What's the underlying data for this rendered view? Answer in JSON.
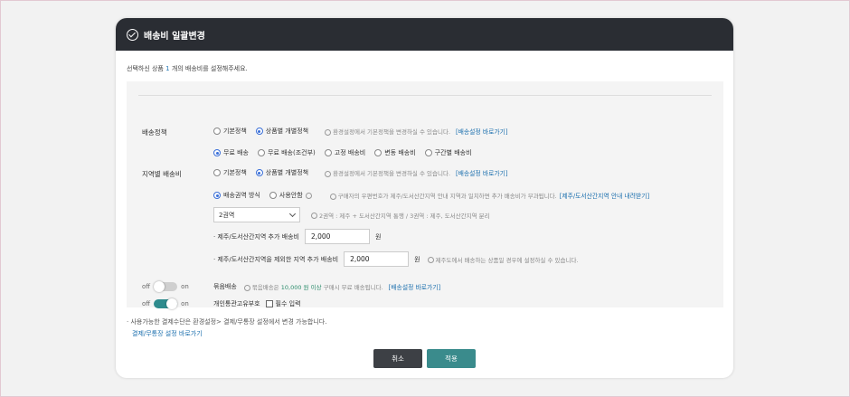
{
  "modal": {
    "title": "배송비 일괄변경",
    "desc_prefix": "선택하신 상품",
    "desc_count": "1",
    "desc_suffix": "개의 배송비를 설정해주세요."
  },
  "policy": {
    "label": "배송정책",
    "options": [
      "기본정책",
      "상품별 개별정책"
    ],
    "hint": "환경설정에서 기본정책을 변경하실 수 있습니다.",
    "link": "[배송설정 바로가기]",
    "fee_types": [
      "무료 배송",
      "무료 배송(조건부)",
      "고정 배송비",
      "변동 배송비",
      "구간별 배송비"
    ]
  },
  "region": {
    "label": "지역별 배송비",
    "options": [
      "기본정책",
      "상품별 개별정책"
    ],
    "hint": "환경설정에서 기본정책을 변경하실 수 있습니다.",
    "link": "[배송설정 바로가기]",
    "methods": [
      "배송권역 방식",
      "사용안함"
    ],
    "method_hint": "구매자의 우편번호가 제주/도서산간지역 안내 지역과 일치하면 추가 배송비가 부과됩니다.",
    "method_link": "[제주/도서산간지역 안내 내려받기]",
    "zone_select": "2권역",
    "zone_hint": "2권역 : 제주 + 도서산간지역 통행 / 3권역 : 제주, 도서산간지역 분리",
    "jeju_label": "· 제주/도서산간지역 추가 배송비",
    "jeju_value": "2,000",
    "jeju_unit": "원",
    "other_label": "· 제주/도서산간지역을 제외한 지역 추가 배송비",
    "other_value": "2,000",
    "other_unit": "원",
    "other_hint": "제주도에서 배송하는 상품일 경우에 설정하실 수 있습니다."
  },
  "bundle": {
    "off": "off",
    "on": "on",
    "label": "묶음배송",
    "hint_prefix": "묶음배송은",
    "hint_amount": "10,000 원 이상",
    "hint_suffix": "구매시 무료 배송됩니다.",
    "link": "[배송설정 바로가기]"
  },
  "customs": {
    "off": "off",
    "on": "on",
    "label": "개인통관고유부호",
    "checkbox_label": "필수 입력"
  },
  "notes": {
    "line1": "· 사용가능한 결제수단은 환경설정> 결제/무통장 설정에서 변경 가능합니다.",
    "line2": "결제/무통장 설정 바로가기"
  },
  "buttons": {
    "cancel": "취소",
    "apply": "적용"
  },
  "colors": {
    "header_bg": "#2a2d33",
    "accent": "#3a8b8c",
    "link": "#1b6fae"
  }
}
